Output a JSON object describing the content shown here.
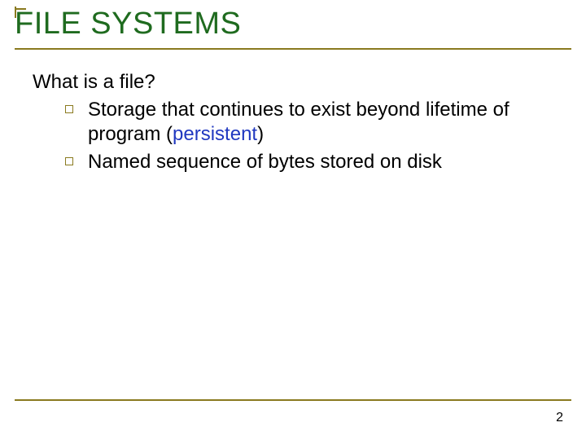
{
  "title": "FILE SYSTEMS",
  "lead": "What is a file?",
  "bullets": [
    {
      "pre": "Storage that continues to exist beyond lifetime of program (",
      "kw": "persistent",
      "post": ")"
    },
    {
      "pre": "Named sequence of bytes stored on disk",
      "kw": "",
      "post": ""
    }
  ],
  "page": "2"
}
